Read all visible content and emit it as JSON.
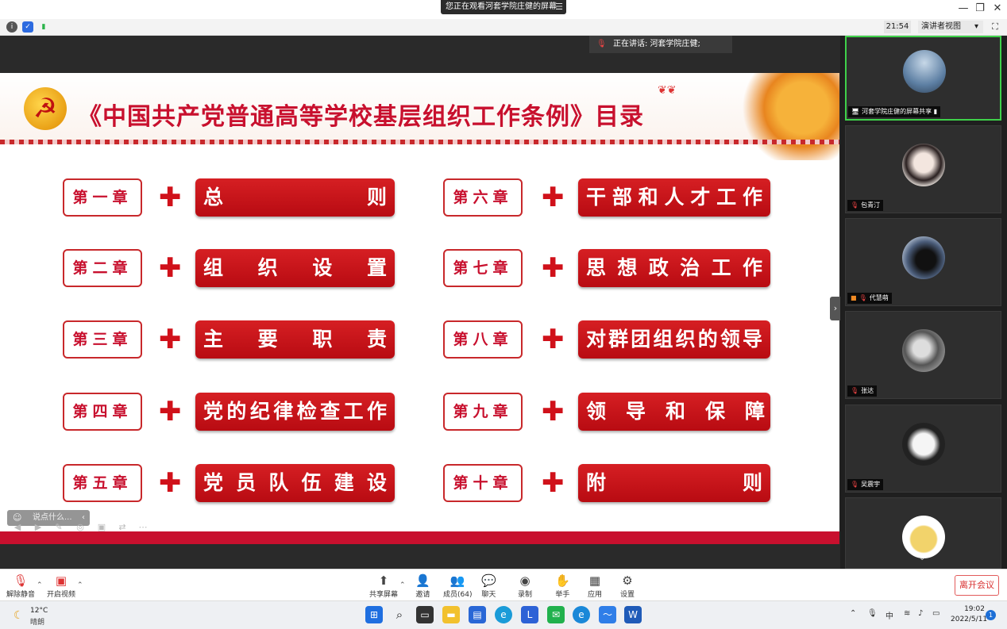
{
  "window": {
    "share_banner": "您正在观看河套学院庄健的屏幕",
    "banner_menu_icon": "menu-icon",
    "controls": [
      "minimize-icon",
      "restore-icon",
      "close-icon"
    ]
  },
  "toolbar": {
    "time": "21:54",
    "view_mode": "演讲者视图",
    "view_mode_caret": "▾",
    "fullscreen_icon": "fullscreen-icon"
  },
  "speaker": {
    "label": "正在讲话: 河套学院庄健;"
  },
  "slide": {
    "title": "《中国共产党普通高等学校基层组织工作条例》目录",
    "emblem": "☭",
    "chapters_left": [
      {
        "chapter": "第一章",
        "title": "总　　　　　则"
      },
      {
        "chapter": "第二章",
        "title": "组　织　设　置"
      },
      {
        "chapter": "第三章",
        "title": "主　要　职　责"
      },
      {
        "chapter": "第四章",
        "title": "党的纪律检查工作"
      },
      {
        "chapter": "第五章",
        "title": "党员队伍建设"
      }
    ],
    "chapters_right": [
      {
        "chapter": "第六章",
        "title": "干部和人才工作"
      },
      {
        "chapter": "第七章",
        "title": "思想政治工作"
      },
      {
        "chapter": "第八章",
        "title": "对群团组织的领导"
      },
      {
        "chapter": "第九章",
        "title": "领　导　和　保　障"
      },
      {
        "chapter": "第十章",
        "title": "附　　　　　则"
      }
    ]
  },
  "annotation": {
    "comment_placeholder": "说点什么...",
    "tools": [
      "arrow-left-icon",
      "arrow-right-icon",
      "pen-icon",
      "target-icon",
      "camera-icon",
      "switch-icon",
      "more-icon"
    ]
  },
  "participants": [
    {
      "name": "河套学院庄健的屏幕共享",
      "active": true,
      "avatar_color": "#5d7fa3"
    },
    {
      "name": "包青汀",
      "active": false,
      "avatar_color": "#e9e2dc"
    },
    {
      "name": "代慧萌",
      "active": false,
      "avatar_color": "#4b5d7a"
    },
    {
      "name": "张达",
      "active": false,
      "avatar_color": "#9a9a9a"
    },
    {
      "name": "吴震宇",
      "active": false,
      "avatar_color": "#222222"
    },
    {
      "name": "",
      "active": false,
      "avatar_color": "#f2d36b"
    }
  ],
  "controls": {
    "unmute": "解除静音",
    "start_video": "开启视频",
    "share_screen": "共享屏幕",
    "invite": "邀请",
    "members": "成员(64)",
    "chat": "聊天",
    "record": "录制",
    "raise_hand": "举手",
    "apps": "应用",
    "settings": "设置",
    "leave": "离开会议"
  },
  "taskbar": {
    "temperature": "12°C",
    "weather": "晴朗",
    "ime": "中",
    "time": "19:02",
    "date": "2022/5/11",
    "notifications": "1"
  }
}
